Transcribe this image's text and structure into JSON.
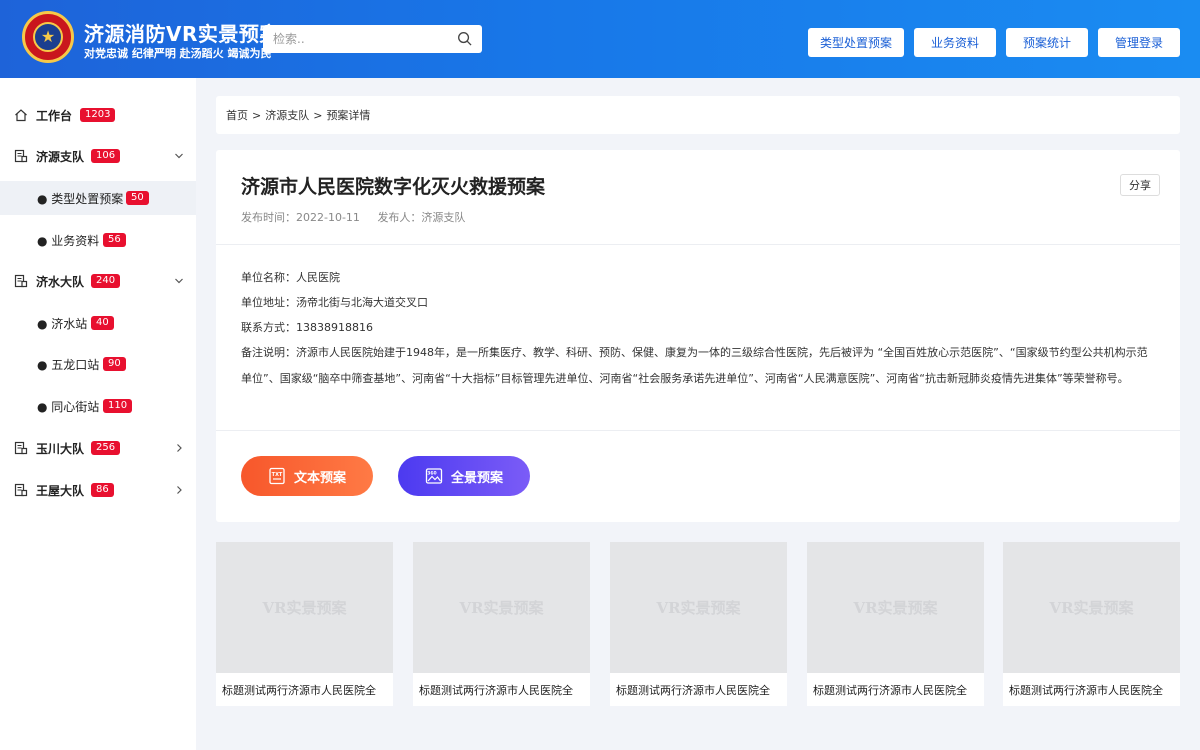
{
  "header": {
    "logo_icon": "fire-rescue-emblem-icon",
    "title": "济源消防VR实景预案",
    "slogan": "对党忠诚 纪律严明 赴汤蹈火 竭诚为民",
    "search_placeholder": "检索..",
    "nav": [
      "类型处置预案",
      "业务资料",
      "预案统计",
      "管理登录"
    ]
  },
  "sidebar": {
    "items": [
      {
        "label": "工作台",
        "badge": "1203"
      },
      {
        "label": "济源支队",
        "badge": "106"
      },
      {
        "label": "● 类型处置预案",
        "badge": "50"
      },
      {
        "label": "● 业务资料",
        "badge": "56"
      },
      {
        "label": "济水大队",
        "badge": "240"
      },
      {
        "label": "● 济水站",
        "badge": "40"
      },
      {
        "label": "● 五龙口站",
        "badge": "90"
      },
      {
        "label": "● 同心街站",
        "badge": "110"
      },
      {
        "label": "玉川大队",
        "badge": "256"
      },
      {
        "label": "王屋大队",
        "badge": "86"
      }
    ]
  },
  "breadcrumb": [
    "首页",
    ">",
    "济源支队",
    ">",
    "预案详情"
  ],
  "detail": {
    "title": "济源市人民医院数字化灭火救援预案",
    "share": "分享",
    "publish_time": "发布时间：2022-10-11",
    "publisher": "发布人：济源支队",
    "unit_name": "单位名称：人民医院",
    "unit_address": "单位地址：汤帝北街与北海大道交叉口",
    "contact": "联系方式：13838918816",
    "note": "备注说明：济源市人民医院始建于1948年，是一所集医疗、教学、科研、预防、保健、康复为一体的三级综合性医院，先后被评为 “全国百姓放心示范医院”、“国家级节约型公共机构示范单位”、国家级“脑卒中筛查基地”、河南省“十大指标”目标管理先进单位、河南省“社会服务承诺先进单位”、河南省“人民满意医院”、河南省“抗击新冠肺炎疫情先进集体”等荣誉称号。",
    "btn_text": "文本预案",
    "btn_pano": "全景预案"
  },
  "cards": [
    {
      "watermark": "VR实景预案",
      "caption": "标题测试两行济源市人民医院全"
    },
    {
      "watermark": "VR实景预案",
      "caption": "标题测试两行济源市人民医院全"
    },
    {
      "watermark": "VR实景预案",
      "caption": "标题测试两行济源市人民医院全"
    },
    {
      "watermark": "VR实景预案",
      "caption": "标题测试两行济源市人民医院全"
    },
    {
      "watermark": "VR实景预案",
      "caption": "标题测试两行济源市人民医院全"
    }
  ]
}
